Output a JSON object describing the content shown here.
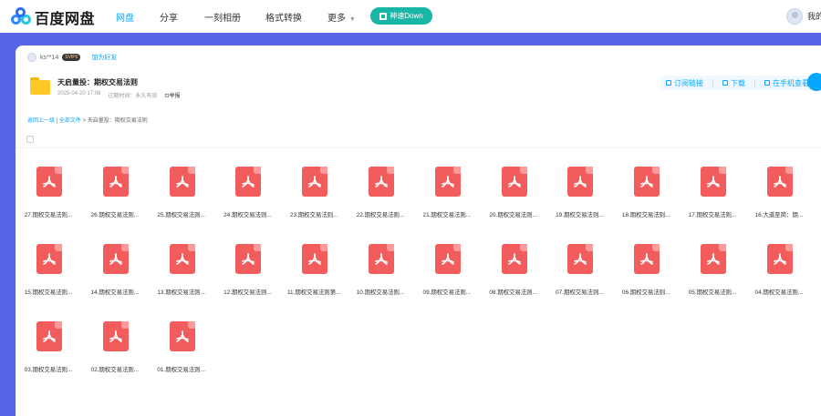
{
  "brand": {
    "name": "百度网盘"
  },
  "nav": {
    "items": [
      "网盘",
      "分享",
      "一刻相册",
      "格式转换",
      "更多"
    ],
    "download_btn": "神速Down",
    "user_label": "我的"
  },
  "share": {
    "user": "ks**14",
    "badge": "SVIP6",
    "add_friend": "加为好友",
    "folder_title": "天启量投：期权交易法则",
    "date": "2025-04-20 17:08",
    "expire_label": "过期时间：",
    "expire_value": "永久有效",
    "report": "举报"
  },
  "actions": {
    "subscribe": "订阅链接",
    "download": "下载",
    "mobile": "在手机查看"
  },
  "breadcrumb": {
    "back": "返回上一级",
    "sep1": "|",
    "all_files": "全部文件",
    "sep2": ">",
    "current": "天启量投：期权交易法则"
  },
  "files": [
    "27.期权交易法则...",
    "26.期权交易法则...",
    "25.期权交易法则...",
    "24.期权交易法则...",
    "23.期权交易法则...",
    "22.期权交易法则...",
    "21.期权交易法则...",
    "20.期权交易法则...",
    "19.期权交易法则...",
    "18.期权交易法则...",
    "17.期权交易法则...",
    "16.大道至简：期...",
    "15.期权交易法则...",
    "14.期权交易法则...",
    "13.期权交易法则...",
    "12.期权交易法则...",
    "11.期权交易法则第...",
    "10.期权交易法则...",
    "09.期权交易法则...",
    "08.期权交易法则...",
    "07.期权交易法则...",
    "06.期权交易法则...",
    "05.期权交易法则...",
    "04.期权交易法则...",
    "03.期权交易法则...",
    "02.期权交易法则...",
    "01.期权交易法则..."
  ],
  "colors": {
    "accent": "#06a7ff",
    "background": "#5664e6",
    "pdf": "#f25c5c",
    "down_button": "#18b6a6"
  }
}
